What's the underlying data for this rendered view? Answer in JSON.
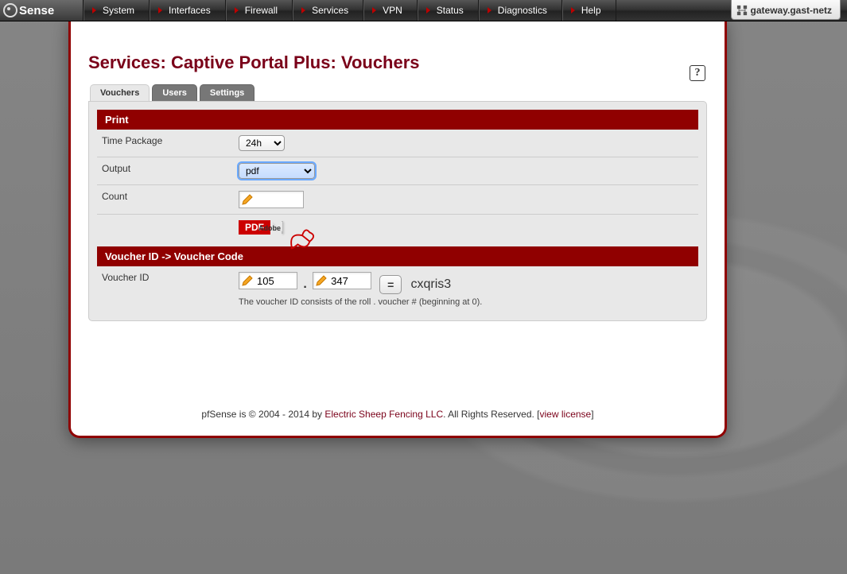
{
  "brand": "Sense",
  "hostname": "gateway.gast-netz",
  "nav": [
    "System",
    "Interfaces",
    "Firewall",
    "Services",
    "VPN",
    "Status",
    "Diagnostics",
    "Help"
  ],
  "page_title": "Services: Captive Portal Plus: Vouchers",
  "tabs": {
    "vouchers": "Vouchers",
    "users": "Users",
    "settings": "Settings"
  },
  "print": {
    "header": "Print",
    "time_package_label": "Time Package",
    "time_package_value": "24h",
    "output_label": "Output",
    "output_value": "pdf",
    "count_label": "Count",
    "count_value": "",
    "pdf_badge": "PDF",
    "pdf_brand": "Adobe"
  },
  "voucher": {
    "header": "Voucher ID -> Voucher Code",
    "id_label": "Voucher ID",
    "roll": "105",
    "num": "347",
    "eq": "=",
    "code": "cxqris3",
    "hint": "The voucher ID consists of the roll . voucher # (beginning at 0)."
  },
  "footer": {
    "pre": "pfSense is © 2004 - 2014 by ",
    "org": "Electric Sheep Fencing LLC",
    "post": ". All Rights Reserved. [",
    "link": "view license",
    "end": "]"
  }
}
